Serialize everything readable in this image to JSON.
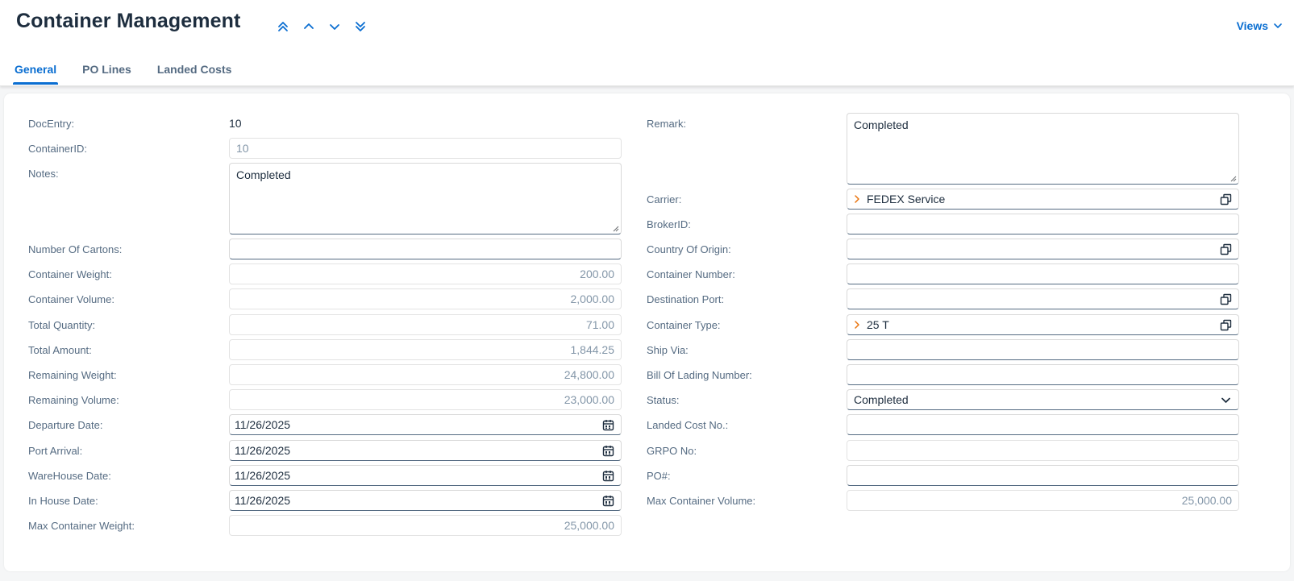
{
  "header": {
    "title": "Container Management",
    "views_label": "Views",
    "nav_icons": [
      "double-chevron-up-icon",
      "chevron-up-icon",
      "chevron-down-icon",
      "double-chevron-down-icon"
    ]
  },
  "tabs": [
    {
      "label": "General",
      "active": true
    },
    {
      "label": "PO Lines",
      "active": false
    },
    {
      "label": "Landed Costs",
      "active": false
    }
  ],
  "colors": {
    "accent": "#0a6ed1",
    "orange_chevron": "#e9730c",
    "label": "#556b82"
  },
  "left": {
    "docentry": {
      "label": "DocEntry:",
      "value": "10"
    },
    "containerid": {
      "label": "ContainerID:",
      "value": "10"
    },
    "notes": {
      "label": "Notes:",
      "value": "Completed"
    },
    "cartons": {
      "label": "Number Of Cartons:",
      "value": ""
    },
    "weight": {
      "label": "Container Weight:",
      "value": "200.00"
    },
    "volume": {
      "label": "Container Volume:",
      "value": "2,000.00"
    },
    "total_qty": {
      "label": "Total Quantity:",
      "value": "71.00"
    },
    "total_amount": {
      "label": "Total Amount:",
      "value": "1,844.25"
    },
    "rem_weight": {
      "label": "Remaining Weight:",
      "value": "24,800.00"
    },
    "rem_volume": {
      "label": "Remaining Volume:",
      "value": "23,000.00"
    },
    "departure": {
      "label": "Departure Date:",
      "value": "11/26/2025"
    },
    "port_arrival": {
      "label": "Port Arrival:",
      "value": "11/26/2025"
    },
    "warehouse_date": {
      "label": "WareHouse Date:",
      "value": "11/26/2025"
    },
    "inhouse_date": {
      "label": "In House Date:",
      "value": "11/26/2025"
    },
    "max_weight": {
      "label": "Max Container Weight:",
      "value": "25,000.00"
    }
  },
  "right": {
    "remark": {
      "label": "Remark:",
      "value": "Completed"
    },
    "carrier": {
      "label": "Carrier:",
      "value": "FEDEX Service"
    },
    "brokerid": {
      "label": "BrokerID:",
      "value": ""
    },
    "country": {
      "label": "Country Of Origin:",
      "value": ""
    },
    "container_number": {
      "label": "Container Number:",
      "value": ""
    },
    "dest_port": {
      "label": "Destination Port:",
      "value": ""
    },
    "container_type": {
      "label": "Container Type:",
      "value": "25 T"
    },
    "ship_via": {
      "label": "Ship Via:",
      "value": ""
    },
    "bol": {
      "label": "Bill Of Lading Number:",
      "value": ""
    },
    "status": {
      "label": "Status:",
      "value": "Completed"
    },
    "landed_cost_no": {
      "label": "Landed Cost No.:",
      "value": ""
    },
    "grpo_no": {
      "label": "GRPO No:",
      "value": ""
    },
    "po_no": {
      "label": "PO#:",
      "value": ""
    },
    "max_volume": {
      "label": "Max Container Volume:",
      "value": "25,000.00"
    }
  }
}
